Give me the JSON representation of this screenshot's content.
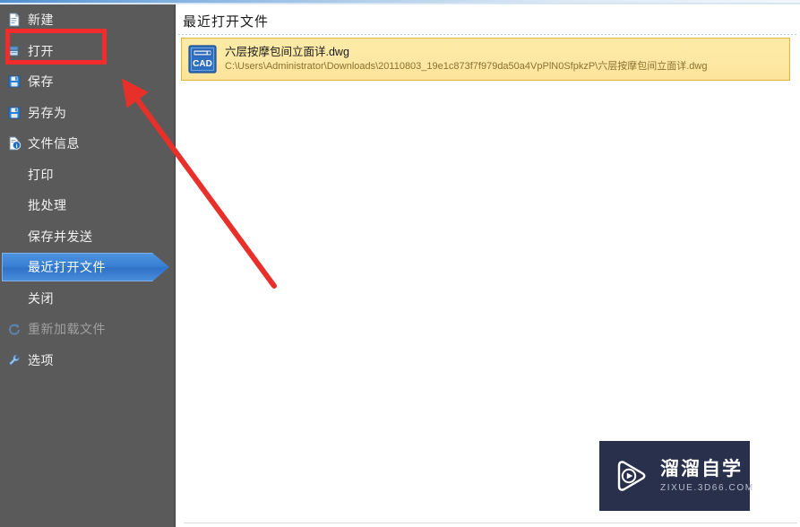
{
  "window": {
    "sidebar_bg": "#5a5a5a",
    "accent": "#3a80d4",
    "annotation_color": "#f22b2b"
  },
  "sidebar": {
    "items": [
      {
        "label": "新建",
        "icon": "new-document-icon",
        "selected": false,
        "disabled": false
      },
      {
        "label": "打开",
        "icon": "open-folder-icon",
        "selected": false,
        "disabled": false
      },
      {
        "label": "保存",
        "icon": "save-disk-icon",
        "selected": false,
        "disabled": false
      },
      {
        "label": "另存为",
        "icon": "save-as-disk-icon",
        "selected": false,
        "disabled": false
      },
      {
        "label": "文件信息",
        "icon": "file-info-icon",
        "selected": false,
        "disabled": false
      },
      {
        "label": "打印",
        "icon": "none",
        "selected": false,
        "disabled": false
      },
      {
        "label": "批处理",
        "icon": "none",
        "selected": false,
        "disabled": false
      },
      {
        "label": "保存并发送",
        "icon": "none",
        "selected": false,
        "disabled": false
      },
      {
        "label": "最近打开文件",
        "icon": "none",
        "selected": true,
        "disabled": false
      },
      {
        "label": "关闭",
        "icon": "none",
        "selected": false,
        "disabled": false
      },
      {
        "label": "重新加载文件",
        "icon": "reload-icon",
        "selected": false,
        "disabled": true
      },
      {
        "label": "选项",
        "icon": "wrench-options-icon",
        "selected": false,
        "disabled": false
      }
    ]
  },
  "content": {
    "title": "最近打开文件",
    "recent_files": [
      {
        "name": "六层按摩包间立面详.dwg",
        "path": "C:\\Users\\Administrator\\Downloads\\20110803_19e1c873f7f979da50a4VpPlN0SfpkzP\\六层按摩包间立面详.dwg",
        "icon": "cad-file-icon",
        "icon_label": "CAD"
      }
    ]
  },
  "watermark": {
    "title": "溜溜自学",
    "subtitle": "ZIXUE.3D66.COM",
    "icon": "play-button-logo-icon",
    "bg": "#29304c"
  }
}
